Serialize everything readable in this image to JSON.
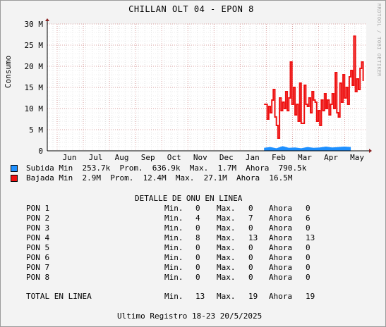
{
  "title": "CHILLAN OLT 04 - EPON 8",
  "side_credit": "RRDTOOL / TOBI OETIKER",
  "colors": {
    "subida": "#1e90ff",
    "bajada": "#ee1111",
    "grid": "#cfcfcf",
    "plot_bg": "#ffffff",
    "frame_bg": "#f3f3f3"
  },
  "chart_data": {
    "type": "area",
    "ylabel": "Consumo",
    "ylim": [
      0,
      30000000
    ],
    "y_ticks": [
      {
        "value": 0,
        "label": "0"
      },
      {
        "value": 5000000,
        "label": "5 M"
      },
      {
        "value": 10000000,
        "label": "10 M"
      },
      {
        "value": 15000000,
        "label": "15 M"
      },
      {
        "value": 20000000,
        "label": "20 M"
      },
      {
        "value": 25000000,
        "label": "25 M"
      },
      {
        "value": 30000000,
        "label": "30 M"
      }
    ],
    "x_labels": [
      "Jun",
      "Jul",
      "Aug",
      "Sep",
      "Oct",
      "Nov",
      "Dec",
      "Jan",
      "Feb",
      "Mar",
      "Apr",
      "May"
    ],
    "grid": true,
    "series": [
      {
        "name": "Subida",
        "style": "area",
        "values": [
          [
            0.7,
            0.7
          ],
          [
            0.72,
            0.9
          ],
          [
            0.74,
            0.6
          ],
          [
            0.76,
            1.1
          ],
          [
            0.78,
            0.7
          ],
          [
            0.8,
            0.8
          ],
          [
            0.82,
            0.6
          ],
          [
            0.84,
            0.9
          ],
          [
            0.86,
            0.7
          ],
          [
            0.88,
            0.8
          ],
          [
            0.9,
            1.0
          ],
          [
            0.92,
            0.8
          ],
          [
            0.94,
            0.9
          ],
          [
            0.96,
            1.0
          ],
          [
            0.98,
            0.9
          ]
        ]
      },
      {
        "name": "Bajada",
        "style": "line",
        "values": [
          [
            0.7,
            11.0
          ],
          [
            0.71,
            7.5
          ],
          [
            0.715,
            10.5
          ],
          [
            0.72,
            9.0
          ],
          [
            0.725,
            12.0
          ],
          [
            0.73,
            14.5
          ],
          [
            0.735,
            8.0
          ],
          [
            0.74,
            6.0
          ],
          [
            0.745,
            3.0
          ],
          [
            0.75,
            12.5
          ],
          [
            0.755,
            9.5
          ],
          [
            0.76,
            11.5
          ],
          [
            0.765,
            10.0
          ],
          [
            0.77,
            14.0
          ],
          [
            0.775,
            9.5
          ],
          [
            0.78,
            12.5
          ],
          [
            0.785,
            21.0
          ],
          [
            0.79,
            11.0
          ],
          [
            0.795,
            15.0
          ],
          [
            0.8,
            8.5
          ],
          [
            0.805,
            11.0
          ],
          [
            0.81,
            7.0
          ],
          [
            0.815,
            16.0
          ],
          [
            0.82,
            6.5
          ],
          [
            0.83,
            15.5
          ],
          [
            0.835,
            11.0
          ],
          [
            0.84,
            10.5
          ],
          [
            0.845,
            12.5
          ],
          [
            0.85,
            9.0
          ],
          [
            0.855,
            14.0
          ],
          [
            0.86,
            12.0
          ],
          [
            0.865,
            11.5
          ],
          [
            0.87,
            7.0
          ],
          [
            0.875,
            9.5
          ],
          [
            0.88,
            6.0
          ],
          [
            0.885,
            12.0
          ],
          [
            0.89,
            9.5
          ],
          [
            0.895,
            13.5
          ],
          [
            0.9,
            10.0
          ],
          [
            0.905,
            12.0
          ],
          [
            0.91,
            8.5
          ],
          [
            0.915,
            11.0
          ],
          [
            0.92,
            13.5
          ],
          [
            0.925,
            10.0
          ],
          [
            0.93,
            18.5
          ],
          [
            0.935,
            9.0
          ],
          [
            0.94,
            8.0
          ],
          [
            0.945,
            16.0
          ],
          [
            0.95,
            11.5
          ],
          [
            0.955,
            18.0
          ],
          [
            0.96,
            12.5
          ],
          [
            0.965,
            15.0
          ],
          [
            0.97,
            11.0
          ],
          [
            0.975,
            17.5
          ],
          [
            0.98,
            19.0
          ],
          [
            0.985,
            15.5
          ],
          [
            0.99,
            27.1
          ],
          [
            0.995,
            14.0
          ],
          [
            1.0,
            17.0
          ],
          [
            1.005,
            14.5
          ],
          [
            1.01,
            19.5
          ],
          [
            1.015,
            21.0
          ],
          [
            1.02,
            16.5
          ]
        ]
      }
    ],
    "legend": [
      {
        "name": "Subida",
        "line": "Subida Min  253.7k  Prom.  636.9k  Max.  1.7M  Ahora  790.5k"
      },
      {
        "name": "Bajada",
        "line": "Bajada Min  2.9M  Prom.  12.4M  Max.  27.1M  Ahora  16.5M"
      }
    ]
  },
  "detail": {
    "title": "DETALLE DE ONU EN LINEA",
    "rows": [
      {
        "name": "PON 1",
        "min_label": "Min.",
        "min": "0",
        "max_label": "Max.",
        "max": "0",
        "now_label": "Ahora",
        "now": "0"
      },
      {
        "name": "PON 2",
        "min_label": "Min.",
        "min": "4",
        "max_label": "Max.",
        "max": "7",
        "now_label": "Ahora",
        "now": "6"
      },
      {
        "name": "PON 3",
        "min_label": "Min.",
        "min": "0",
        "max_label": "Max.",
        "max": "0",
        "now_label": "Ahora",
        "now": "0"
      },
      {
        "name": "PON 4",
        "min_label": "Min.",
        "min": "8",
        "max_label": "Max.",
        "max": "13",
        "now_label": "Ahora",
        "now": "13"
      },
      {
        "name": "PON 5",
        "min_label": "Min.",
        "min": "0",
        "max_label": "Max.",
        "max": "0",
        "now_label": "Ahora",
        "now": "0"
      },
      {
        "name": "PON 6",
        "min_label": "Min.",
        "min": "0",
        "max_label": "Max.",
        "max": "0",
        "now_label": "Ahora",
        "now": "0"
      },
      {
        "name": "PON 7",
        "min_label": "Min.",
        "min": "0",
        "max_label": "Max.",
        "max": "0",
        "now_label": "Ahora",
        "now": "0"
      },
      {
        "name": "PON 8",
        "min_label": "Min.",
        "min": "0",
        "max_label": "Max.",
        "max": "0",
        "now_label": "Ahora",
        "now": "0"
      }
    ],
    "total": {
      "name": "TOTAL EN LINEA",
      "min_label": "Min.",
      "min": "13",
      "max_label": "Max.",
      "max": "19",
      "now_label": "Ahora",
      "now": "19"
    }
  },
  "footer": "Ultimo Registro 18-23 20/5/2025"
}
